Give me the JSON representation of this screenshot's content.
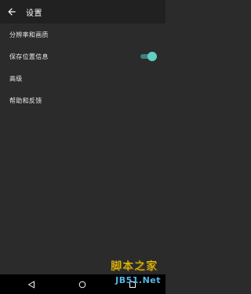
{
  "header": {
    "title": "设置"
  },
  "settings": [
    {
      "label": "分辨率和画质"
    },
    {
      "label": "保存位置信息",
      "toggle": {
        "on": true
      }
    },
    {
      "label": "高级"
    },
    {
      "label": "帮助和反馈"
    }
  ],
  "watermark": {
    "line1": "脚本之家",
    "line2": "JB51.Net"
  },
  "colors": {
    "accent": "#5fd0c2",
    "background": "#2b2b2b",
    "app_bar": "#212121"
  },
  "icons": {
    "back": "arrow-left-icon",
    "nav_back": "nav-back-icon",
    "nav_home": "nav-home-icon",
    "nav_recent": "nav-recent-icon"
  }
}
